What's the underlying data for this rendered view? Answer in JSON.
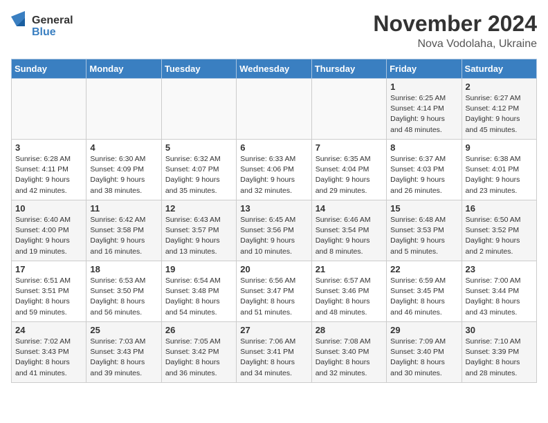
{
  "header": {
    "logo_general": "General",
    "logo_blue": "Blue",
    "month_title": "November 2024",
    "subtitle": "Nova Vodolaha, Ukraine"
  },
  "days_of_week": [
    "Sunday",
    "Monday",
    "Tuesday",
    "Wednesday",
    "Thursday",
    "Friday",
    "Saturday"
  ],
  "weeks": [
    [
      {
        "day": "",
        "info": ""
      },
      {
        "day": "",
        "info": ""
      },
      {
        "day": "",
        "info": ""
      },
      {
        "day": "",
        "info": ""
      },
      {
        "day": "",
        "info": ""
      },
      {
        "day": "1",
        "info": "Sunrise: 6:25 AM\nSunset: 4:14 PM\nDaylight: 9 hours\nand 48 minutes."
      },
      {
        "day": "2",
        "info": "Sunrise: 6:27 AM\nSunset: 4:12 PM\nDaylight: 9 hours\nand 45 minutes."
      }
    ],
    [
      {
        "day": "3",
        "info": "Sunrise: 6:28 AM\nSunset: 4:11 PM\nDaylight: 9 hours\nand 42 minutes."
      },
      {
        "day": "4",
        "info": "Sunrise: 6:30 AM\nSunset: 4:09 PM\nDaylight: 9 hours\nand 38 minutes."
      },
      {
        "day": "5",
        "info": "Sunrise: 6:32 AM\nSunset: 4:07 PM\nDaylight: 9 hours\nand 35 minutes."
      },
      {
        "day": "6",
        "info": "Sunrise: 6:33 AM\nSunset: 4:06 PM\nDaylight: 9 hours\nand 32 minutes."
      },
      {
        "day": "7",
        "info": "Sunrise: 6:35 AM\nSunset: 4:04 PM\nDaylight: 9 hours\nand 29 minutes."
      },
      {
        "day": "8",
        "info": "Sunrise: 6:37 AM\nSunset: 4:03 PM\nDaylight: 9 hours\nand 26 minutes."
      },
      {
        "day": "9",
        "info": "Sunrise: 6:38 AM\nSunset: 4:01 PM\nDaylight: 9 hours\nand 23 minutes."
      }
    ],
    [
      {
        "day": "10",
        "info": "Sunrise: 6:40 AM\nSunset: 4:00 PM\nDaylight: 9 hours\nand 19 minutes."
      },
      {
        "day": "11",
        "info": "Sunrise: 6:42 AM\nSunset: 3:58 PM\nDaylight: 9 hours\nand 16 minutes."
      },
      {
        "day": "12",
        "info": "Sunrise: 6:43 AM\nSunset: 3:57 PM\nDaylight: 9 hours\nand 13 minutes."
      },
      {
        "day": "13",
        "info": "Sunrise: 6:45 AM\nSunset: 3:56 PM\nDaylight: 9 hours\nand 10 minutes."
      },
      {
        "day": "14",
        "info": "Sunrise: 6:46 AM\nSunset: 3:54 PM\nDaylight: 9 hours\nand 8 minutes."
      },
      {
        "day": "15",
        "info": "Sunrise: 6:48 AM\nSunset: 3:53 PM\nDaylight: 9 hours\nand 5 minutes."
      },
      {
        "day": "16",
        "info": "Sunrise: 6:50 AM\nSunset: 3:52 PM\nDaylight: 9 hours\nand 2 minutes."
      }
    ],
    [
      {
        "day": "17",
        "info": "Sunrise: 6:51 AM\nSunset: 3:51 PM\nDaylight: 8 hours\nand 59 minutes."
      },
      {
        "day": "18",
        "info": "Sunrise: 6:53 AM\nSunset: 3:50 PM\nDaylight: 8 hours\nand 56 minutes."
      },
      {
        "day": "19",
        "info": "Sunrise: 6:54 AM\nSunset: 3:48 PM\nDaylight: 8 hours\nand 54 minutes."
      },
      {
        "day": "20",
        "info": "Sunrise: 6:56 AM\nSunset: 3:47 PM\nDaylight: 8 hours\nand 51 minutes."
      },
      {
        "day": "21",
        "info": "Sunrise: 6:57 AM\nSunset: 3:46 PM\nDaylight: 8 hours\nand 48 minutes."
      },
      {
        "day": "22",
        "info": "Sunrise: 6:59 AM\nSunset: 3:45 PM\nDaylight: 8 hours\nand 46 minutes."
      },
      {
        "day": "23",
        "info": "Sunrise: 7:00 AM\nSunset: 3:44 PM\nDaylight: 8 hours\nand 43 minutes."
      }
    ],
    [
      {
        "day": "24",
        "info": "Sunrise: 7:02 AM\nSunset: 3:43 PM\nDaylight: 8 hours\nand 41 minutes."
      },
      {
        "day": "25",
        "info": "Sunrise: 7:03 AM\nSunset: 3:43 PM\nDaylight: 8 hours\nand 39 minutes."
      },
      {
        "day": "26",
        "info": "Sunrise: 7:05 AM\nSunset: 3:42 PM\nDaylight: 8 hours\nand 36 minutes."
      },
      {
        "day": "27",
        "info": "Sunrise: 7:06 AM\nSunset: 3:41 PM\nDaylight: 8 hours\nand 34 minutes."
      },
      {
        "day": "28",
        "info": "Sunrise: 7:08 AM\nSunset: 3:40 PM\nDaylight: 8 hours\nand 32 minutes."
      },
      {
        "day": "29",
        "info": "Sunrise: 7:09 AM\nSunset: 3:40 PM\nDaylight: 8 hours\nand 30 minutes."
      },
      {
        "day": "30",
        "info": "Sunrise: 7:10 AM\nSunset: 3:39 PM\nDaylight: 8 hours\nand 28 minutes."
      }
    ]
  ]
}
